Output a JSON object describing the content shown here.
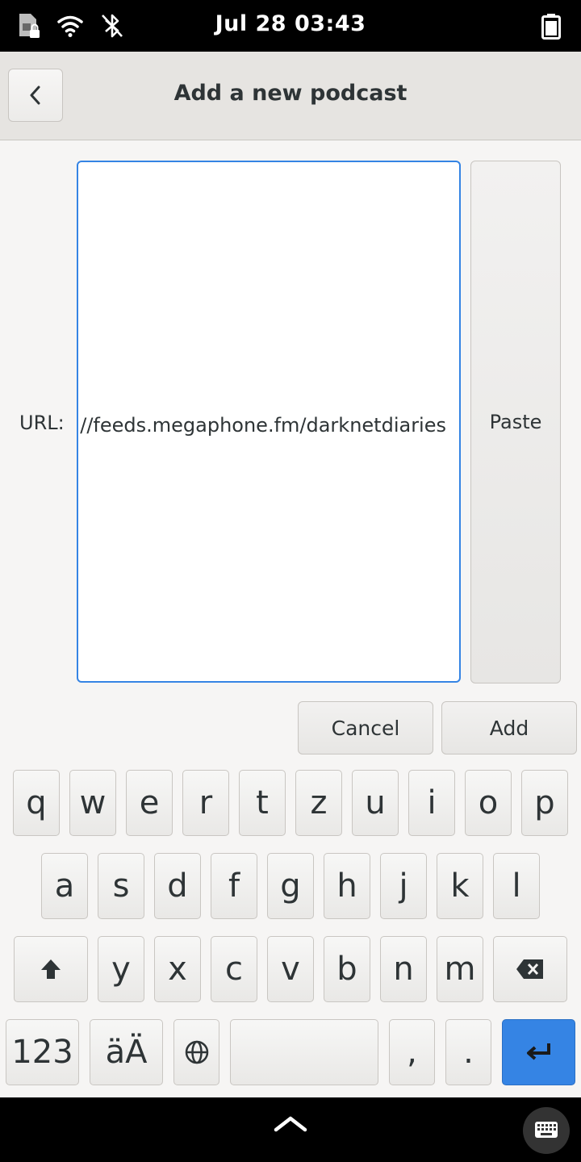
{
  "status_bar": {
    "clock": "Jul 28  03:43",
    "icons": [
      "sim-card-locked-icon",
      "wifi-icon",
      "bluetooth-disabled-icon",
      "battery-icon"
    ]
  },
  "header": {
    "title": "Add a new podcast",
    "back_icon": "chevron-left-icon"
  },
  "form": {
    "url_label": "URL:",
    "url_value": "https://feeds.megaphone.fm/darknetdiaries",
    "paste_label": "Paste",
    "cancel_label": "Cancel",
    "add_label": "Add",
    "accent_color": "#3584e4"
  },
  "keyboard": {
    "row1": [
      "q",
      "w",
      "e",
      "r",
      "t",
      "z",
      "u",
      "i",
      "o",
      "p"
    ],
    "row2": [
      "a",
      "s",
      "d",
      "f",
      "g",
      "h",
      "j",
      "k",
      "l"
    ],
    "row3": [
      "y",
      "x",
      "c",
      "v",
      "b",
      "n",
      "m"
    ],
    "numbers_label": "123",
    "umlaut_label": "äÄ",
    "comma_label": ",",
    "period_label": ".",
    "shift_icon": "shift-arrow-icon",
    "backspace_icon": "backspace-icon",
    "globe_icon": "globe-icon",
    "enter_icon": "enter-icon"
  },
  "bottom_bar": {
    "handle_icon": "chevron-up-icon",
    "keyboard_toggle_icon": "keyboard-icon"
  }
}
